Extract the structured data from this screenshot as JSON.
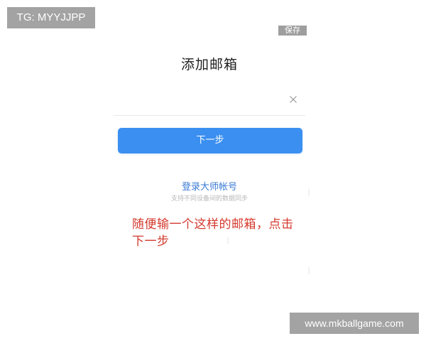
{
  "overlay": {
    "tg_badge": "TG: MYYJJPP",
    "watermark": "www.mkballgame.com"
  },
  "header": {
    "save_label": "保存",
    "title": "添加邮箱"
  },
  "email_field": {
    "value": "",
    "clear_icon": "close-icon"
  },
  "actions": {
    "next_label": "下一步",
    "master_account_label": "登录大师帐号",
    "master_account_sub": "支持不同设备间的数据同步"
  },
  "annotation": {
    "text": "随便输一个这样的邮箱，点击下一步"
  },
  "colors": {
    "primary_button": "#3b8ff0",
    "link": "#3a7bd5",
    "annotation": "#d43a2e",
    "overlay_bg": "#a3a3a3"
  }
}
